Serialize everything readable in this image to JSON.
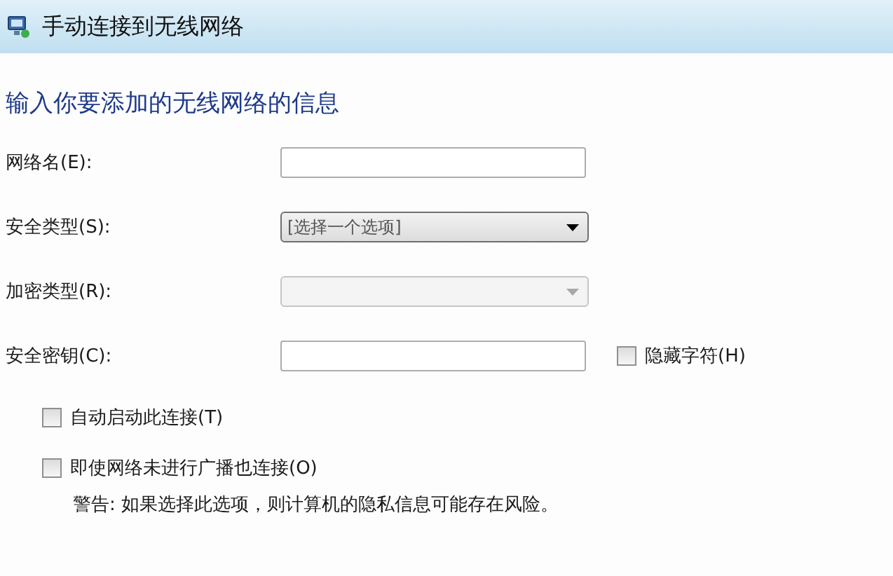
{
  "window": {
    "title": "手动连接到无线网络"
  },
  "heading": "输入你要添加的无线网络的信息",
  "fields": [
    {
      "label": "网络名(E):",
      "kind": "text"
    },
    {
      "label": "安全类型(S):",
      "kind": "select",
      "value": "[选择一个选项]",
      "disabled": false
    },
    {
      "label": "加密类型(R):",
      "kind": "select",
      "disabled": true
    },
    {
      "label": "安全密钥(C):",
      "kind": "text",
      "checkbox": {
        "label": "隐藏字符(H)",
        "checked": false
      }
    }
  ],
  "options": [
    {
      "label": "自动启动此连接(T)",
      "checked": false
    },
    {
      "label": "即使网络未进行广播也连接(O)",
      "checked": false
    }
  ],
  "warning": "警告: 如果选择此选项，则计算机的隐私信息可能存在风险。"
}
